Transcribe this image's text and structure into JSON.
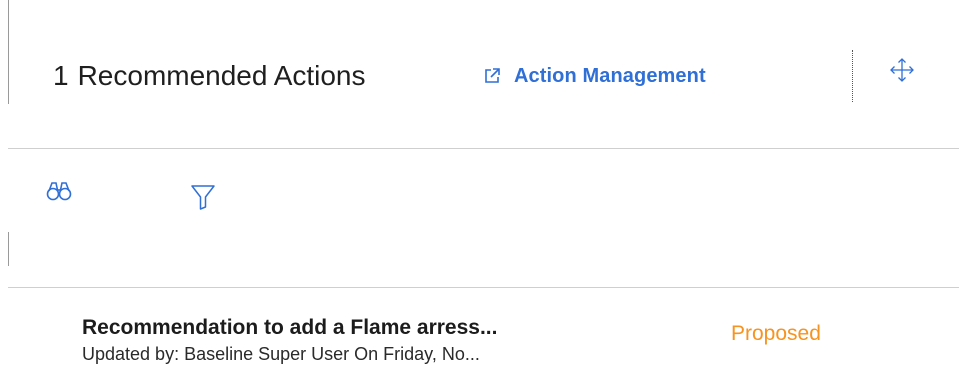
{
  "header": {
    "count": "1",
    "title": "Recommended Actions",
    "link_label": "Action Management"
  },
  "icons": {
    "external_link": "external-link-icon",
    "move": "move-arrows-icon",
    "search": "binoculars-icon",
    "filter": "filter-icon"
  },
  "actions": [
    {
      "title": "Recommendation to add a Flame arress...",
      "subtitle": "Updated by: Baseline Super User On  Friday, No...",
      "status": "Proposed"
    }
  ],
  "colors": {
    "accent": "#2f6fd6",
    "status_proposed": "#f7931e",
    "divider": "#cfcfcf"
  }
}
